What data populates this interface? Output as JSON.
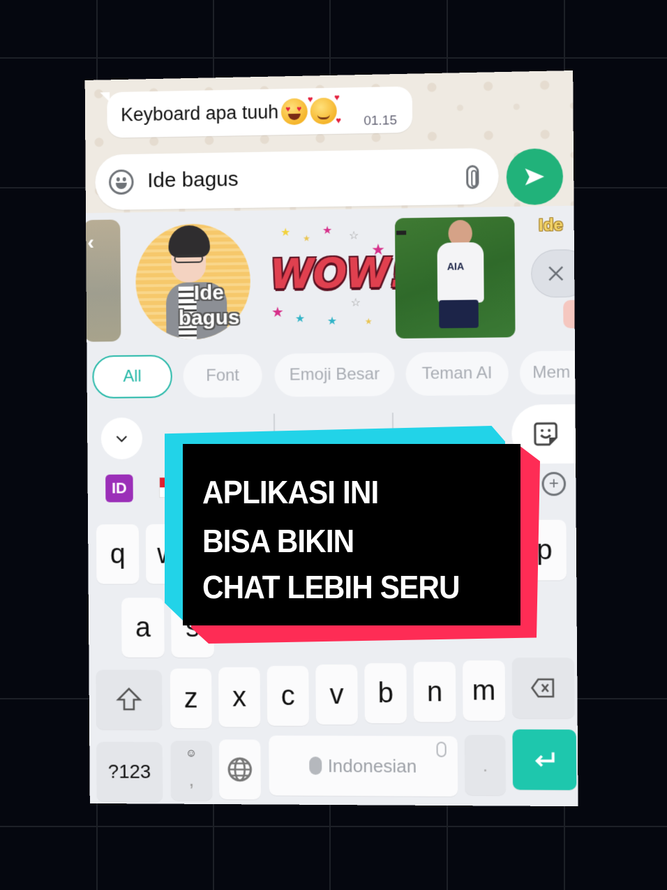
{
  "chat": {
    "message": {
      "text": "Keyboard apa tuuh",
      "emojis": [
        "heart-eyes",
        "smiling-face-with-hearts"
      ],
      "time": "01.15"
    },
    "input": {
      "value": "Ide bagus",
      "placeholder": ""
    },
    "icons": {
      "emoji": "smiley-icon",
      "attach": "paperclip-icon",
      "send": "send-icon"
    },
    "colors": {
      "send": "#21b27a"
    }
  },
  "stickers": {
    "items": [
      {
        "type": "partial-sticker",
        "label": ""
      },
      {
        "type": "avatar-sticker",
        "caption": "Ide bagus",
        "caption_lines": [
          "Ide",
          "bagus"
        ]
      },
      {
        "type": "text-sticker",
        "text": "WOW!"
      },
      {
        "type": "photo-gif",
        "sponsor": "AIA"
      },
      {
        "type": "partial-sticker",
        "caption": "Ide"
      }
    ],
    "close_label": "×"
  },
  "categories": {
    "chips": [
      {
        "label": "All",
        "active": true
      },
      {
        "label": "Font",
        "active": false
      },
      {
        "label": "Emoji Besar",
        "active": false
      },
      {
        "label": "Teman AI",
        "active": false
      },
      {
        "label": "Mem",
        "active": false
      }
    ],
    "accent": "#25b8a8"
  },
  "toolbar": {
    "collapse_icon": "chevron-down-icon",
    "sticker_icon": "sticker-smile-icon",
    "language_badge": "ID",
    "add_icon": "plus-circle-icon"
  },
  "keyboard": {
    "row1_visible": [
      "q",
      "w",
      "p"
    ],
    "row2_visible": [
      "a",
      "s"
    ],
    "row3": [
      "z",
      "x",
      "c",
      "v",
      "b",
      "n",
      "m"
    ],
    "shift_icon": "shift-arrow-icon",
    "backspace_icon": "backspace-icon",
    "symbols_label": "?123",
    "comma_label": ",",
    "globe_icon": "globe-icon",
    "space_label": "Indonesian",
    "period_label": ".",
    "enter_icon": "enter-arrow-icon",
    "enter_color": "#1ec7ad"
  },
  "overlay": {
    "lines": [
      "APLIKASI INI",
      "BISA BIKIN",
      "CHAT LEBIH SERU"
    ],
    "colors": {
      "cyan": "#22d3e8",
      "red": "#fe2c55",
      "box": "#000000"
    }
  }
}
